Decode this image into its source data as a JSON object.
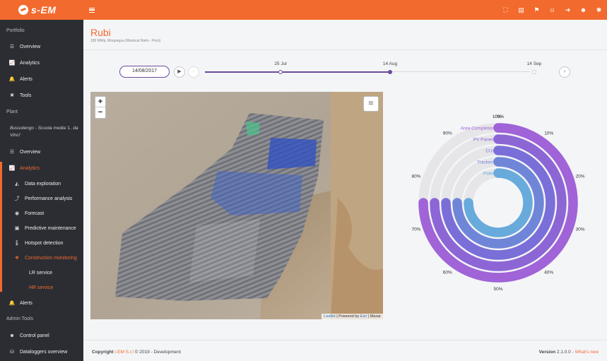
{
  "brand": {
    "name": "s-EM"
  },
  "topbar": {
    "icons": [
      "fullscreen-icon",
      "presentation-icon",
      "flag-icon",
      "user-icon",
      "logout-icon",
      "users-icon",
      "settings-icon"
    ]
  },
  "sidebar": {
    "portfolio_label": "Portfolio",
    "portfolio_items": [
      {
        "label": "Overview",
        "icon": "list-icon"
      },
      {
        "label": "Analytics",
        "icon": "chart-icon"
      },
      {
        "label": "Alerts",
        "icon": "bell-icon"
      },
      {
        "label": "Tools",
        "icon": "tools-icon"
      }
    ],
    "plant_label": "Plant",
    "plant_name": "Bussolengo - Scuola media 'L. da Vinci'",
    "plant_items": [
      {
        "label": "Overview",
        "icon": "list-icon"
      },
      {
        "label": "Analytics",
        "icon": "chart-icon"
      },
      {
        "label": "Data exploration",
        "icon": "area-chart-icon"
      },
      {
        "label": "Performance analysis",
        "icon": "line-chart-icon"
      },
      {
        "label": "Forecast",
        "icon": "eye-icon"
      },
      {
        "label": "Predictive maintenance",
        "icon": "briefcase-icon"
      },
      {
        "label": "Hotspot detection",
        "icon": "thermometer-icon"
      },
      {
        "label": "Construction monitoring",
        "icon": "cubes-icon"
      },
      {
        "label": "LR service"
      },
      {
        "label": "HR service"
      },
      {
        "label": "Alerts",
        "icon": "bell-icon"
      }
    ],
    "admin_label": "Admin Tools",
    "admin_items": [
      {
        "label": "Control panel",
        "icon": "users-icon"
      },
      {
        "label": "Dataloggers overview",
        "icon": "database-icon"
      }
    ]
  },
  "page": {
    "title": "Rubi",
    "subtitle": "180 MWp, Moquegua (Mariscal Nieto - Perù)"
  },
  "timeline": {
    "date_value": "14/08/2017",
    "ticks": [
      {
        "label": "25 Jul",
        "state": "passed"
      },
      {
        "label": "14 Aug",
        "state": "current"
      },
      {
        "label": "14 Sep",
        "state": "future"
      }
    ]
  },
  "map": {
    "attribution_leaflet": "Leaflet",
    "attribution_powered": "| Powered by",
    "attribution_esri": "Esri",
    "attribution_maxar": "| Maxar"
  },
  "chart_data": {
    "type": "radial-bar",
    "series": [
      {
        "name": "Area Completion",
        "value": 75,
        "color": "#a063d8"
      },
      {
        "name": "PV Panels",
        "value": 75,
        "color": "#8d66d6"
      },
      {
        "name": "CUs",
        "value": 75,
        "color": "#7a6ed9"
      },
      {
        "name": "Trackers",
        "value": 75,
        "color": "#6f86d8"
      },
      {
        "name": "Poles",
        "value": 75,
        "color": "#68aadc"
      }
    ],
    "axis_labels": [
      "0%",
      "10%",
      "20%",
      "30%",
      "40%",
      "50%",
      "60%",
      "70%",
      "80%",
      "90%",
      "100%"
    ],
    "track_color": "#e6e6e8"
  },
  "footer": {
    "copyright": "Copyright",
    "org": "i-EM S.r.l",
    "rest": "© 2019 - Development",
    "version_label": "Version",
    "version": "2.1.0.0",
    "separator": "-",
    "whats_new": "What's new"
  }
}
